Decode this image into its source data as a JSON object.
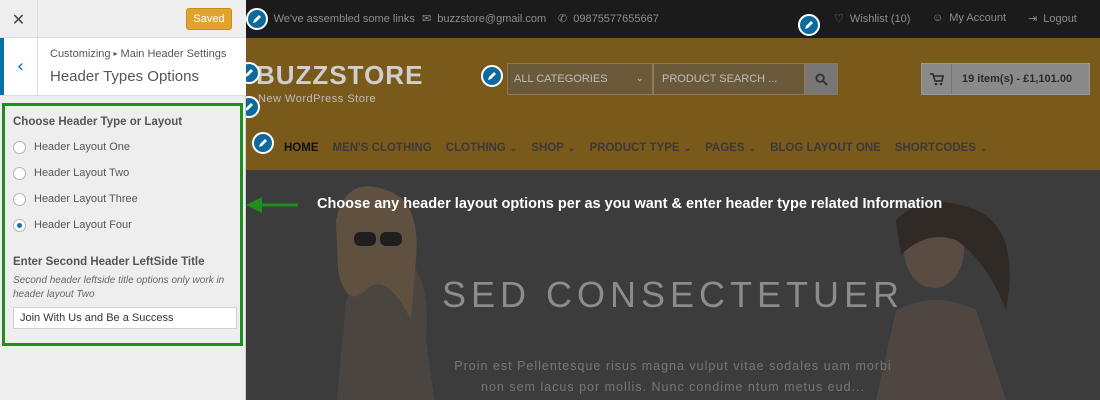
{
  "panel": {
    "close_label": "✕",
    "saved_label": "Saved",
    "back_label": "‹",
    "breadcrumb_root": "Customizing",
    "breadcrumb_sep": "▸",
    "breadcrumb_section": "Main Header Settings",
    "title": "Header Types Options",
    "header_type": {
      "heading": "Choose Header Type or Layout",
      "options": [
        "Header Layout One",
        "Header Layout Two",
        "Header Layout Three",
        "Header Layout Four"
      ],
      "selected": "Header Layout Four"
    },
    "leftside_title": {
      "heading": "Enter Second Header LeftSide Title",
      "description": "Second header leftside title options only work in header layout Two",
      "value": "Join With Us and Be a Success"
    }
  },
  "preview": {
    "topbar": {
      "links_text": "We've assembled some links",
      "email": "buzzstore@gmail.com",
      "phone": "09875577655667",
      "wishlist": "Wishlist (10)",
      "account": "My Account",
      "logout": "Logout"
    },
    "header": {
      "logo": "BUZZSTORE",
      "tagline": "New WordPress Store",
      "category_select": "ALL CATEGORIES",
      "search_placeholder": "PRODUCT  SEARCH ...",
      "cart_text": "19 item(s) - £1,101.00"
    },
    "nav": [
      "HOME",
      "MEN'S CLOTHING",
      "CLOTHING",
      "SHOP",
      "PRODUCT TYPE",
      "PAGES",
      "BLOG LAYOUT ONE",
      "SHORTCODES"
    ],
    "hero": {
      "title": "SED CONSECTETUER",
      "text_line1": "Proin est Pellentesque risus magna vulput vitae sodales uam morbi",
      "text_line2": "non sem lacus por mollis. Nunc condime ntum metus eud..."
    },
    "annotation": "Choose any header layout options per as you want & enter header type related Information"
  },
  "colors": {
    "accent_blue": "#0073aa",
    "saved_orange": "#e0a32e",
    "highlight_green": "#1e8e1e",
    "header_brown": "#7a5a1b",
    "topbar_dark": "#1b1b1b"
  }
}
